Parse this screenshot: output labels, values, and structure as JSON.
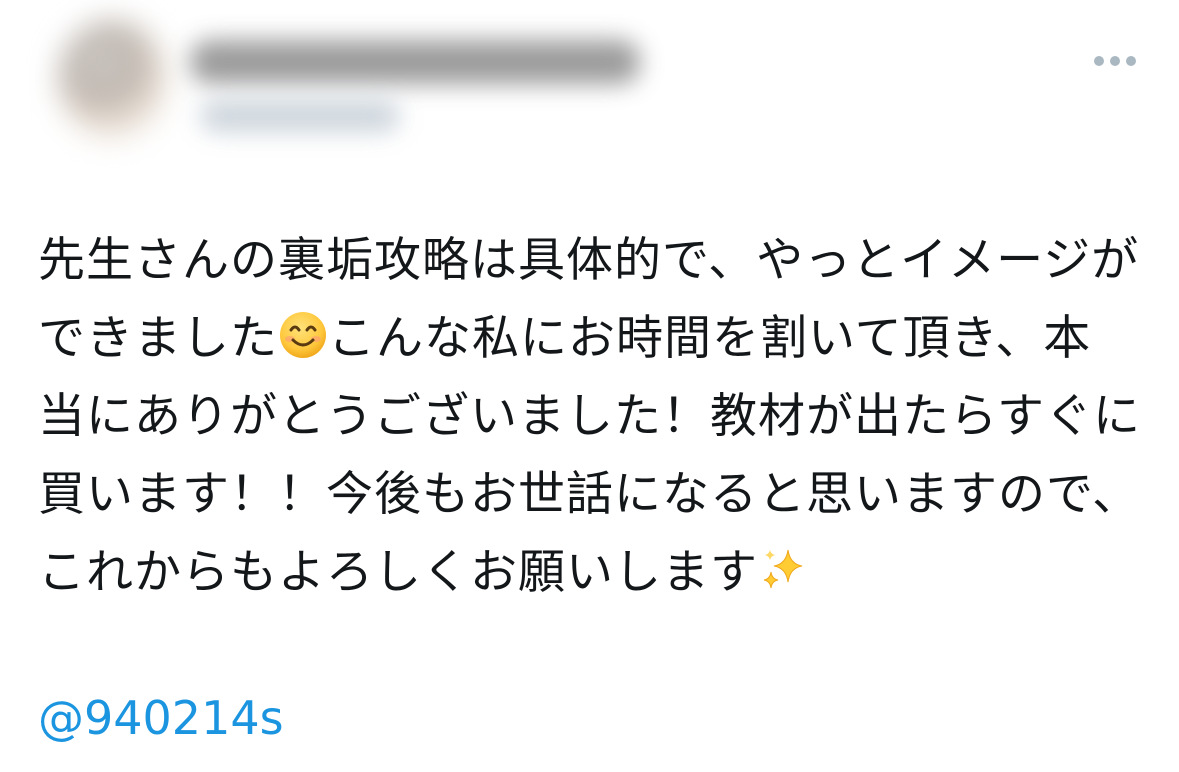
{
  "tweet": {
    "body_lines": [
      "先生さんの裏垢攻略は具体的で、やっとイメージが",
      "できました",
      "こんな私にお時間を割いて頂き、本",
      "当にありがとうございました！教材が出たらすぐに",
      "買います！！今後もお世話になると思いますので、",
      "これからもよろしくお願いします"
    ],
    "emoji_smile": "smiling-face-emoji",
    "emoji_sparkles": "sparkles-emoji",
    "mention": "@940214s"
  },
  "colors": {
    "text": "#14171a",
    "link": "#1b95e0",
    "icon": "#aab8c2"
  }
}
